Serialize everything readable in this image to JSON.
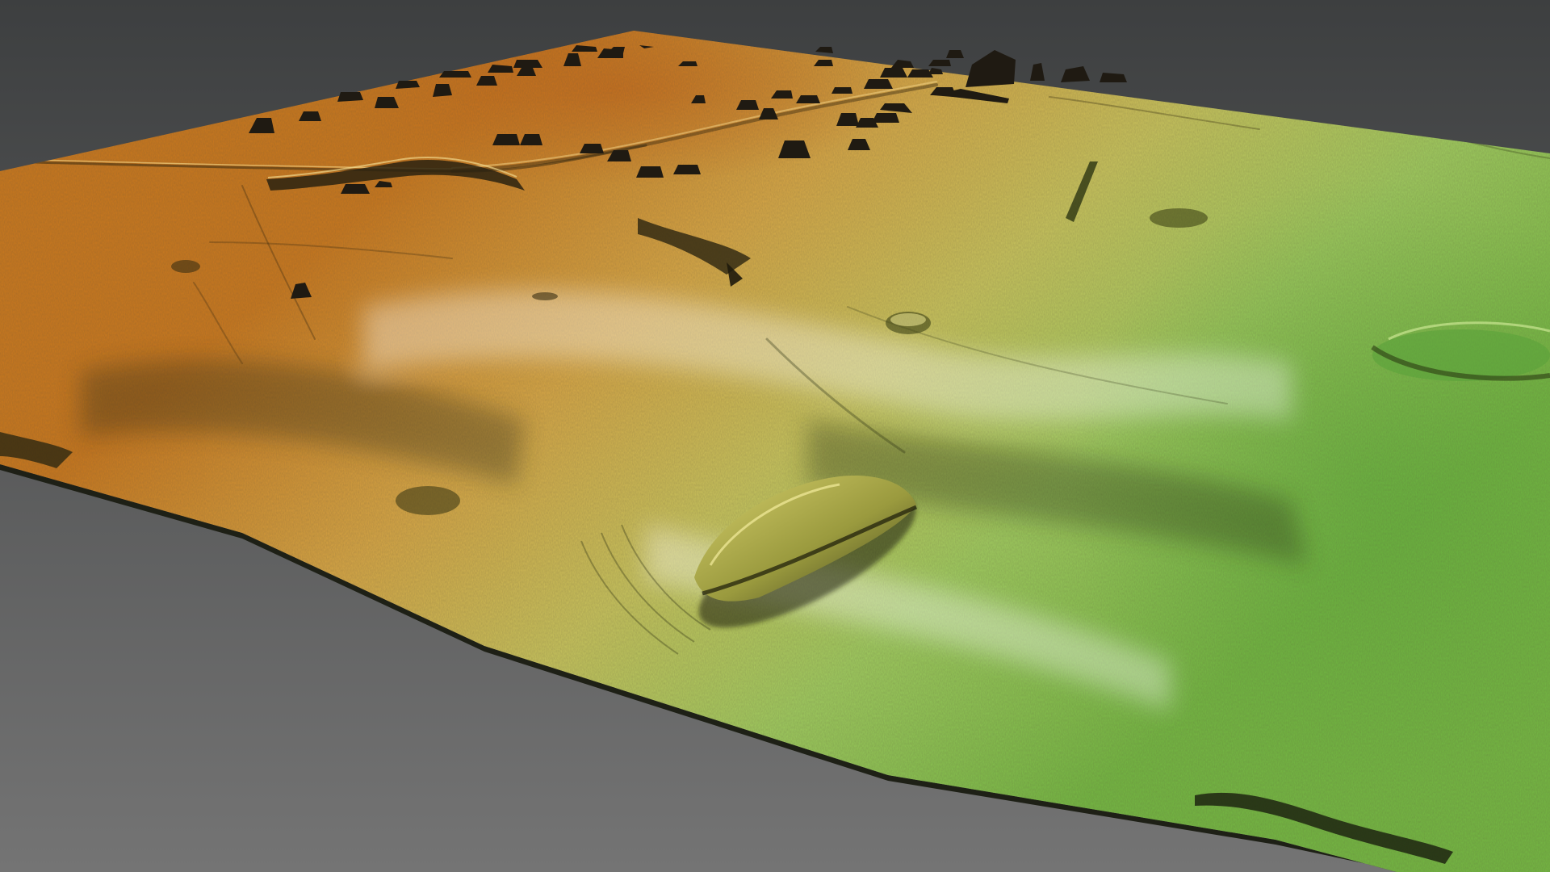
{
  "scene": {
    "kind": "3d-lidar-terrain-render",
    "background": {
      "top": "#3d3f40",
      "bottom": "#747474"
    },
    "elevation_colors": {
      "high": "#c9781f",
      "upper": "#d6a646",
      "mid": "#c7c35d",
      "lower": "#9fcb5f",
      "low": "#74b843"
    },
    "shadow_color": "#1f1a12"
  }
}
